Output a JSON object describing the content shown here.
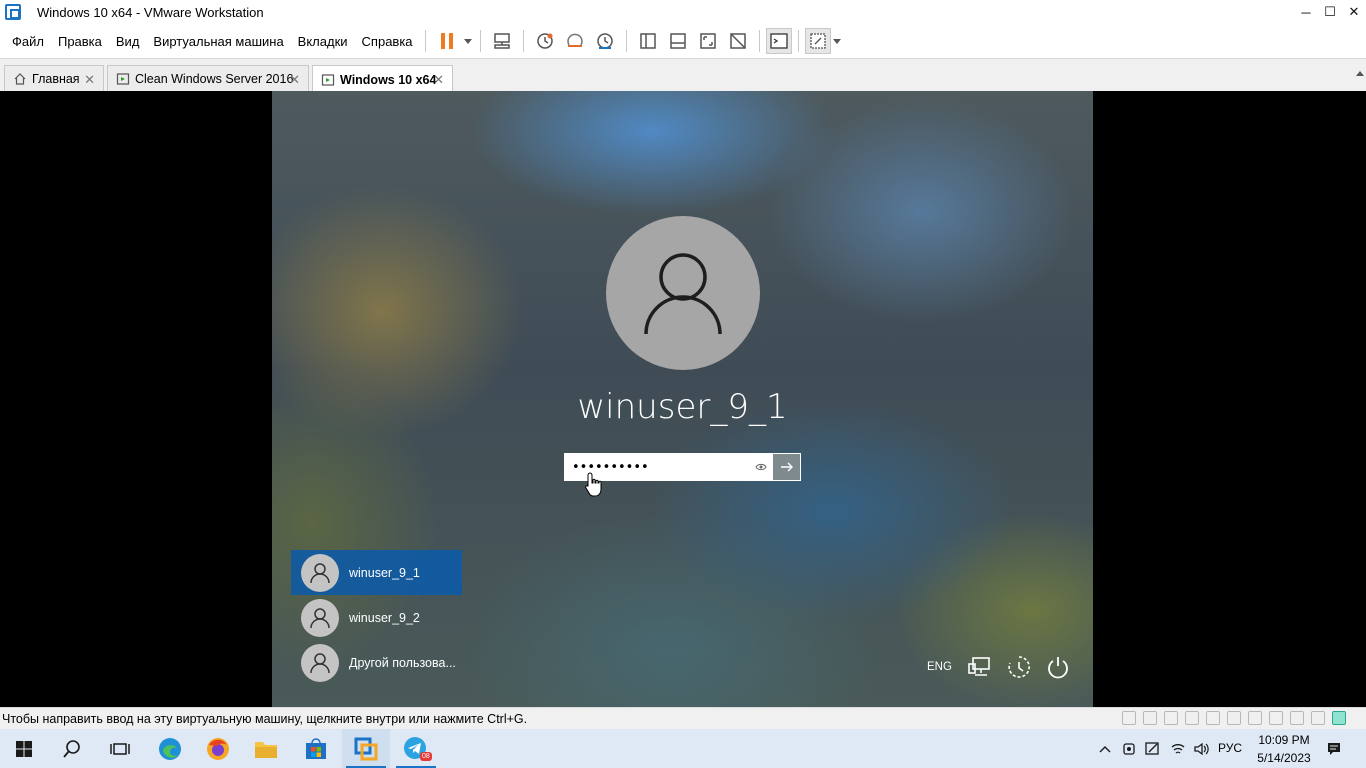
{
  "window": {
    "title": "Windows 10 x64 - VMware Workstation",
    "controls": {
      "minimize": "─",
      "maximize": "☐",
      "close": "✕"
    }
  },
  "menu": {
    "items": [
      "Файл",
      "Правка",
      "Вид",
      "Виртуальная машина",
      "Вкладки",
      "Справка"
    ]
  },
  "tabs": [
    {
      "label": "Главная",
      "icon": "home-icon"
    },
    {
      "label": "Clean Windows Server 2016",
      "icon": "vm-icon"
    },
    {
      "label": "Windows 10 x64",
      "icon": "vm-icon",
      "active": true
    }
  ],
  "lockscreen": {
    "username": "winuser_9_1",
    "password_value": "••••••••••",
    "users": [
      {
        "name": "winuser_9_1",
        "selected": true
      },
      {
        "name": "winuser_9_2"
      },
      {
        "name": "Другой пользова..."
      }
    ],
    "input_language": "ENG"
  },
  "statusbar": {
    "hint": "Чтобы направить ввод на эту виртуальную машину, щелкните внутри или нажмите Ctrl+G."
  },
  "taskbar": {
    "telegram_badge": "08",
    "input_language": "РУС",
    "time": "10:09 PM",
    "date": "5/14/2023"
  },
  "colors": {
    "selected_user_bg": "#0e5aa0",
    "pause_orange": "#f07c22",
    "taskbar_bg": "#dfe9f5",
    "accent": "#1a73c7"
  }
}
